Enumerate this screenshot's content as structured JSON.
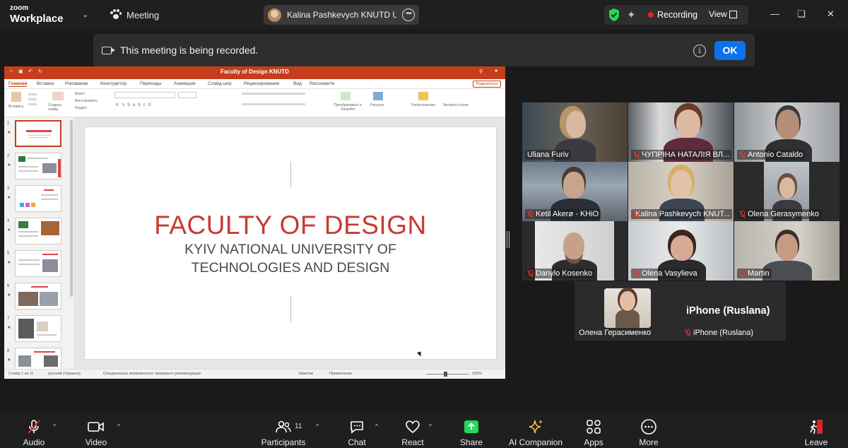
{
  "app": {
    "brand_line1": "zoom",
    "brand_line2": "Workplace",
    "meeting_label": "Meeting",
    "active_speaker": "Kalina Pashkevych KNUTD Ukrain",
    "recording_label": "Recording",
    "view_label": "View",
    "accent_green": "#23d959",
    "accent_blue": "#0e72ed",
    "recording_red": "#e02424"
  },
  "notification": {
    "text": "This meeting is being recorded.",
    "ok_label": "OK"
  },
  "presentation": {
    "window_title": "Faculty of Design KNUTD",
    "tabs": [
      "Главная",
      "Вставка",
      "Рисование",
      "Конструктор",
      "Переходы",
      "Анимация",
      "Слайд-шоу",
      "Рецензирование",
      "Вид",
      "Расскажите"
    ],
    "share_button": "Поделиться",
    "ribbon": {
      "paste": "Вставить",
      "new_slide": "Создать слайд",
      "layout": "Макет",
      "reset": "Восстановить",
      "section": "Раздел",
      "smartart": "Преобразовать в SmartArt",
      "picture": "Рисунок",
      "arrange": "Расположение",
      "quick_styles": "Экспресс-стили"
    },
    "thumbnail_numbers": [
      "1",
      "2",
      "3",
      "4",
      "5",
      "6",
      "7",
      "8"
    ],
    "slide_title": "FACULTY OF DESIGN",
    "slide_subtitle_1": "KYIV NATIONAL UNIVERSITY OF",
    "slide_subtitle_2": "TECHNOLOGIES AND DESIGN",
    "slide_title_color": "#c73a34",
    "status": {
      "slide_count": "Слайд 1 из 11",
      "language": "русский (Украина)",
      "accessibility": "Специальные возможности: проверьте рекомендации",
      "notes": "Заметки",
      "comments": "Примечания",
      "zoom": "155%"
    }
  },
  "participants_gallery": [
    {
      "name": "Uliana Furiv",
      "muted": false,
      "active": true
    },
    {
      "name": "ЧУПРІНА НАТАЛІЯ ВЛ...",
      "muted": true
    },
    {
      "name": "Antonio Cataldo",
      "muted": true
    },
    {
      "name": "Ketil Akerø - KHiO",
      "muted": true
    },
    {
      "name": "Kalina Pashkevych KNUT...",
      "muted": true
    },
    {
      "name": "Olena Gerasymenko",
      "muted": true
    },
    {
      "name": "Danylo Kosenko",
      "muted": true
    },
    {
      "name": "Olena Vasylieva",
      "muted": true
    },
    {
      "name": "Martin",
      "muted": true
    }
  ],
  "extra_tiles": {
    "left_name": "Олена Герасименко",
    "right_name": "iPhone (Ruslana)",
    "right_big": "iPhone (Ruslana)"
  },
  "toolbar": {
    "audio": "Audio",
    "video": "Video",
    "participants": "Participants",
    "participants_count": "11",
    "chat": "Chat",
    "react": "React",
    "share": "Share",
    "ai_companion": "AI Companion",
    "apps": "Apps",
    "more": "More",
    "leave": "Leave"
  }
}
